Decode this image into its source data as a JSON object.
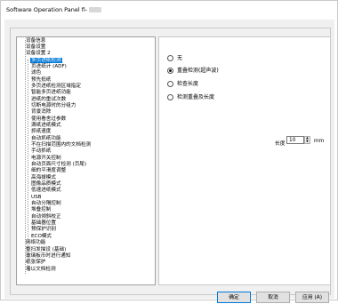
{
  "window": {
    "title": "Software Operation Panel fi-"
  },
  "tree": {
    "items": [
      {
        "label": "设备信息",
        "level": 0,
        "selected": false
      },
      {
        "label": "设备设置",
        "level": 0,
        "selected": false
      },
      {
        "label": "设备设置 2",
        "level": 0,
        "selected": false
      },
      {
        "label": "多页进纸检测",
        "level": 1,
        "selected": true
      },
      {
        "label": "页进纸计 (ADF)",
        "level": 1,
        "selected": false
      },
      {
        "label": "滤色",
        "level": 1,
        "selected": false
      },
      {
        "label": "预先抵纸",
        "level": 1,
        "selected": false
      },
      {
        "label": "多页进纸检测区域指定",
        "level": 1,
        "selected": false
      },
      {
        "label": "智能多页进纸功能",
        "level": 1,
        "selected": false
      },
      {
        "label": "进纸的重试次数",
        "level": 1,
        "selected": false
      },
      {
        "label": "切断电源时的分组力",
        "level": 1,
        "selected": false
      },
      {
        "label": "背景消除",
        "level": 1,
        "selected": false
      },
      {
        "label": "使用看舍过参数",
        "level": 1,
        "selected": false
      },
      {
        "label": "满纸进纸模式",
        "level": 1,
        "selected": false
      },
      {
        "label": "抓纸速度",
        "level": 1,
        "selected": false
      },
      {
        "label": "自动抓纸功能",
        "level": 1,
        "selected": false
      },
      {
        "label": "不在扫描范围内的文档检测",
        "level": 1,
        "selected": false
      },
      {
        "label": "手动抓纸",
        "level": 1,
        "selected": false
      },
      {
        "label": "电源开关控制",
        "level": 1,
        "selected": false
      },
      {
        "label": "自动页面尺寸检测 (页尾)",
        "level": 1,
        "selected": false
      },
      {
        "label": "细的平滑度调整",
        "level": 1,
        "selected": false
      },
      {
        "label": "高海拔模式",
        "level": 1,
        "selected": false
      },
      {
        "label": "图像品质模式",
        "level": 1,
        "selected": false
      },
      {
        "label": "低速进纸模式",
        "level": 1,
        "selected": false
      },
      {
        "label": "USB",
        "level": 1,
        "selected": false
      },
      {
        "label": "自动分隔控制",
        "level": 1,
        "selected": false
      },
      {
        "label": "堆叠控制",
        "level": 1,
        "selected": false
      },
      {
        "label": "自动倾斜校正",
        "level": 1,
        "selected": false
      },
      {
        "label": "基础器位置",
        "level": 1,
        "selected": false
      },
      {
        "label": "预保护识别",
        "level": 1,
        "selected": false
      },
      {
        "label": "ECO模式",
        "level": 1,
        "selected": false
      },
      {
        "label": "网络功能",
        "level": 0,
        "selected": false
      },
      {
        "label": "整扫发描设 (基础)",
        "level": 0,
        "selected": false
      },
      {
        "label": "玻璃板币时进行通知",
        "level": 0,
        "selected": false
      },
      {
        "label": "纸张保护",
        "level": 0,
        "selected": false
      },
      {
        "label": "堵以文档检测",
        "level": 0,
        "selected": false
      }
    ]
  },
  "options": {
    "none": "无",
    "overlap": "重叠检测(超声波)",
    "length": "检查长度",
    "overlap_and_length": "检测重叠及长度",
    "selected": "overlap"
  },
  "length": {
    "label": "长度",
    "value": "10",
    "unit": "mm"
  },
  "buttons": {
    "ok": "确定",
    "cancel": "取消",
    "apply": "应用 (A)"
  }
}
